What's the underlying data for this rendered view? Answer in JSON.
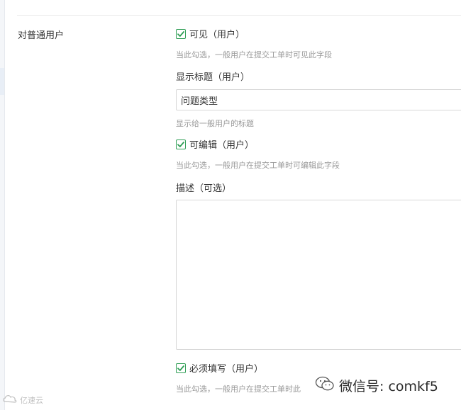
{
  "section": {
    "label": "对普通用户"
  },
  "visible": {
    "label": "可见（用户）",
    "hint": "当此勾选，一般用户在提交工单时可见此字段",
    "checked": true
  },
  "display_title": {
    "label": "显示标题（用户）",
    "value": "问题类型",
    "hint": "显示给一般用户的标题"
  },
  "editable": {
    "label": "可编辑（用户）",
    "hint": "当此勾选，一般用户在提交工单时可编辑此字段",
    "checked": true
  },
  "description": {
    "label": "描述（可选）",
    "value": ""
  },
  "required": {
    "label": "必须填写（用户）",
    "hint": "当此勾选，一般用户在提交工单时此",
    "checked": true
  },
  "watermark": {
    "wechat": "微信号: comkf5",
    "left_text": "亿速云"
  },
  "colors": {
    "check_accent": "#2f9e55",
    "hint_text": "#999999",
    "border": "#d7d7d7"
  },
  "icons": {
    "checkbox": "checkbox-checked-icon",
    "wechat": "wechat-icon"
  }
}
